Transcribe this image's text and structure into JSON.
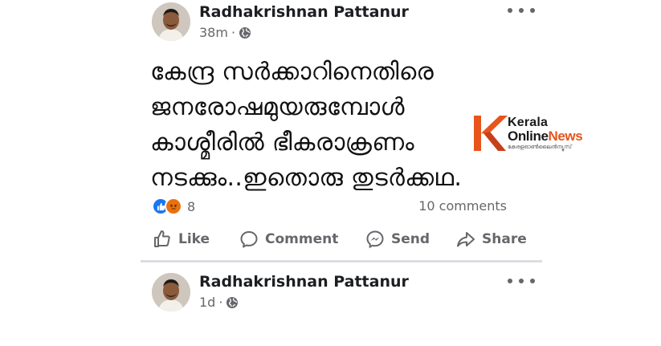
{
  "post1": {
    "author": "Radhakrishnan Pattanur",
    "time": "38m",
    "separator": "·",
    "text_lines": [
      "കേന്ദ്ര സർക്കാറിനെതിരെ",
      "ജനരോഷമുയരുമ്പോൾ",
      "കാശ്മീരിൽ ഭീകരാക്രണം",
      "നടക്കും..ഇതൊരു തുടർക്കഥ."
    ],
    "watermark": {
      "kerala": "Kerala",
      "online": "Online",
      "news": "News",
      "sub": "കേരളഓൺലൈൻന്യൂസ്"
    },
    "reaction_count": "8",
    "comments_count": "10 comments",
    "actions": {
      "like": "Like",
      "comment": "Comment",
      "send": "Send",
      "share": "Share"
    }
  },
  "post2": {
    "author": "Radhakrishnan Pattanur",
    "time": "1d",
    "separator": "·"
  },
  "colors": {
    "text_primary": "#1c1e21",
    "text_secondary": "#65676b",
    "like_blue": "#1877f2",
    "angry_orange": "#e9710f",
    "divider": "#dadde1",
    "logo_accent": "#e8541b"
  },
  "icons": [
    "globe-icon",
    "more-icon",
    "like-icon",
    "comment-icon",
    "messenger-icon",
    "share-icon"
  ]
}
